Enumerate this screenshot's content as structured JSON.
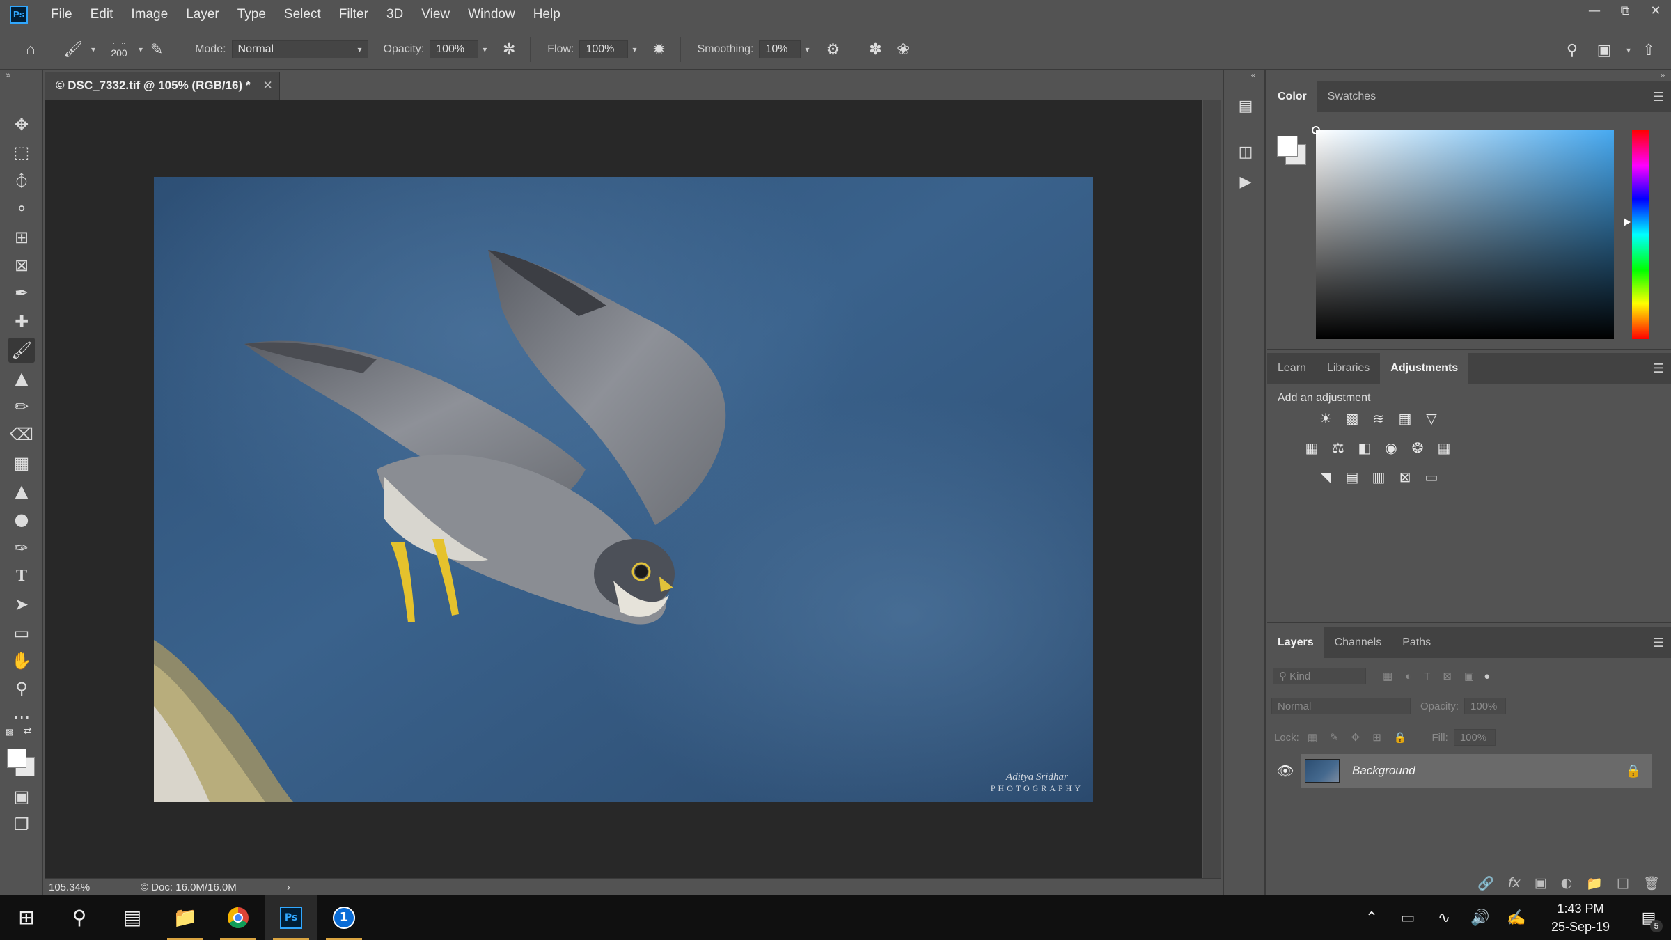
{
  "app": {
    "logo_text": "Ps"
  },
  "menu": [
    "File",
    "Edit",
    "Image",
    "Layer",
    "Type",
    "Select",
    "Filter",
    "3D",
    "View",
    "Window",
    "Help"
  ],
  "options_bar": {
    "brush_size": "200",
    "mode_label": "Mode:",
    "mode_value": "Normal",
    "opacity_label": "Opacity:",
    "opacity_value": "100%",
    "flow_label": "Flow:",
    "flow_value": "100%",
    "smoothing_label": "Smoothing:",
    "smoothing_value": "10%"
  },
  "document": {
    "tab_title": "© DSC_7332.tif @ 105% (RGB/16) *",
    "watermark_signature": "Aditya Sridhar",
    "watermark_sub": "PHOTOGRAPHY"
  },
  "status": {
    "zoom": "105.34%",
    "doc_info": "© Doc: 16.0M/16.0M",
    "arrow": "›"
  },
  "color_panel": {
    "tabs": [
      "Color",
      "Swatches"
    ],
    "active_tab": "Color",
    "foreground": "#ffffff",
    "background": "#e8e8e8"
  },
  "adjustments_panel": {
    "tabs": [
      "Learn",
      "Libraries",
      "Adjustments"
    ],
    "active_tab": "Adjustments",
    "title": "Add an adjustment"
  },
  "layers_panel": {
    "tabs": [
      "Layers",
      "Channels",
      "Paths"
    ],
    "active_tab": "Layers",
    "filter_placeholder": "Kind",
    "blend_mode": "Normal",
    "opacity_label": "Opacity:",
    "opacity_value": "100%",
    "lock_label": "Lock:",
    "fill_label": "Fill:",
    "fill_value": "100%",
    "layers": [
      {
        "name": "Background",
        "visible": true,
        "locked": true
      }
    ]
  },
  "taskbar": {
    "time": "1:43 PM",
    "date": "25-Sep-19",
    "notifications": "5"
  },
  "colors": {
    "accent": "#31a8ff",
    "ui_bg": "#535353",
    "canvas_bg": "#282828"
  }
}
